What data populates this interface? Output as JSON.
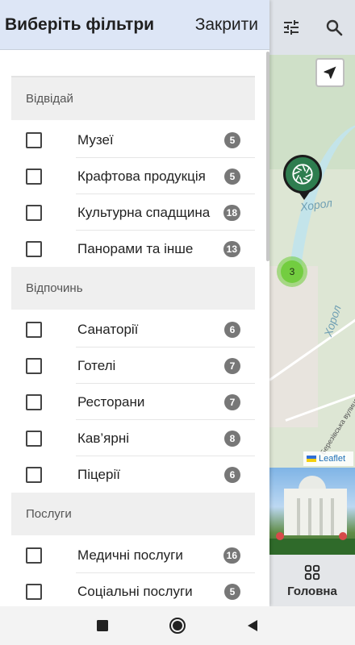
{
  "drawer": {
    "title": "Виберіть фільтри",
    "close_label": "Закрити"
  },
  "sections": [
    {
      "title": "Відвідай",
      "items": [
        {
          "label": "Музеї",
          "count": "5"
        },
        {
          "label": "Крафтова продукція",
          "count": "5"
        },
        {
          "label": "Культурна спадщина",
          "count": "18"
        },
        {
          "label": "Панорами та інше",
          "count": "13"
        }
      ]
    },
    {
      "title": "Відпочинь",
      "items": [
        {
          "label": "Санаторії",
          "count": "6"
        },
        {
          "label": "Готелі",
          "count": "7"
        },
        {
          "label": "Ресторани",
          "count": "7"
        },
        {
          "label": "Кав’ярні",
          "count": "8"
        },
        {
          "label": "Піцерії",
          "count": "6"
        }
      ]
    },
    {
      "title": "Послуги",
      "items": [
        {
          "label": "Медичні послуги",
          "count": "16"
        },
        {
          "label": "Соціальні послуги",
          "count": "5"
        }
      ]
    }
  ],
  "map": {
    "cluster_count": "3",
    "river_label_1": "Хорол",
    "river_label_2": "Хорол",
    "street_label": "Березівська вулиця",
    "attribution": "Leaflet"
  },
  "bottom_nav": {
    "home_label": "Головна"
  },
  "icons": {
    "filter": "tune-icon",
    "search": "search-icon",
    "locate": "navigation-arrow-icon",
    "photo_marker": "camera-aperture-icon",
    "home": "grid-icon",
    "sys_recents": "square-icon",
    "sys_home": "circle-icon",
    "sys_back": "triangle-back-icon"
  },
  "colors": {
    "header_bg": "#dde6f6",
    "section_bg": "#efefef",
    "badge_bg": "#777777",
    "marker_green": "#2e7d4f"
  }
}
